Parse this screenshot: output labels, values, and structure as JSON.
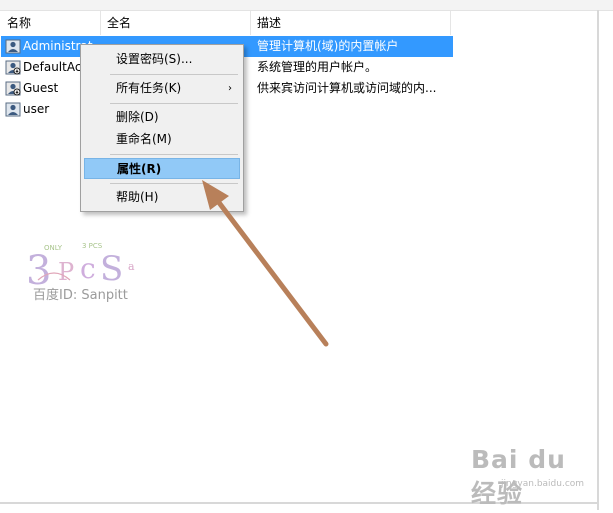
{
  "columns": [
    "名称",
    "全名",
    "描述"
  ],
  "rows": [
    {
      "name": "Administrat",
      "full_name": "",
      "description": "管理计算机(域)的内置帐户",
      "selected": true
    },
    {
      "name": "DefaultAcc",
      "full_name": "",
      "description": "系统管理的用户帐户。",
      "selected": false
    },
    {
      "name": "Guest",
      "full_name": "",
      "description": "供来宾访问计算机或访问域的内...",
      "selected": false
    },
    {
      "name": "user",
      "full_name": "",
      "description": "",
      "selected": false
    }
  ],
  "context_menu": {
    "items": [
      {
        "label": "设置密码(S)...",
        "has_submenu": false,
        "highlighted": false
      },
      {
        "label": "所有任务(K)",
        "has_submenu": true,
        "highlighted": false
      },
      {
        "label": "删除(D)",
        "has_submenu": false,
        "highlighted": false
      },
      {
        "label": "重命名(M)",
        "has_submenu": false,
        "highlighted": false
      },
      {
        "label": "属性(R)",
        "has_submenu": false,
        "highlighted": true
      },
      {
        "label": "帮助(H)",
        "has_submenu": false,
        "highlighted": false
      }
    ],
    "submenu_glyph": "›"
  },
  "watermark": {
    "text": "百度ID: Sanpitt"
  },
  "baidu_watermark": {
    "brand": "Bai du 经验",
    "url": "jingyan.baidu.com"
  },
  "colors": {
    "selection": "#3399ff",
    "menu_highlight": "#91c9f7",
    "arrow": "#b8805a"
  }
}
